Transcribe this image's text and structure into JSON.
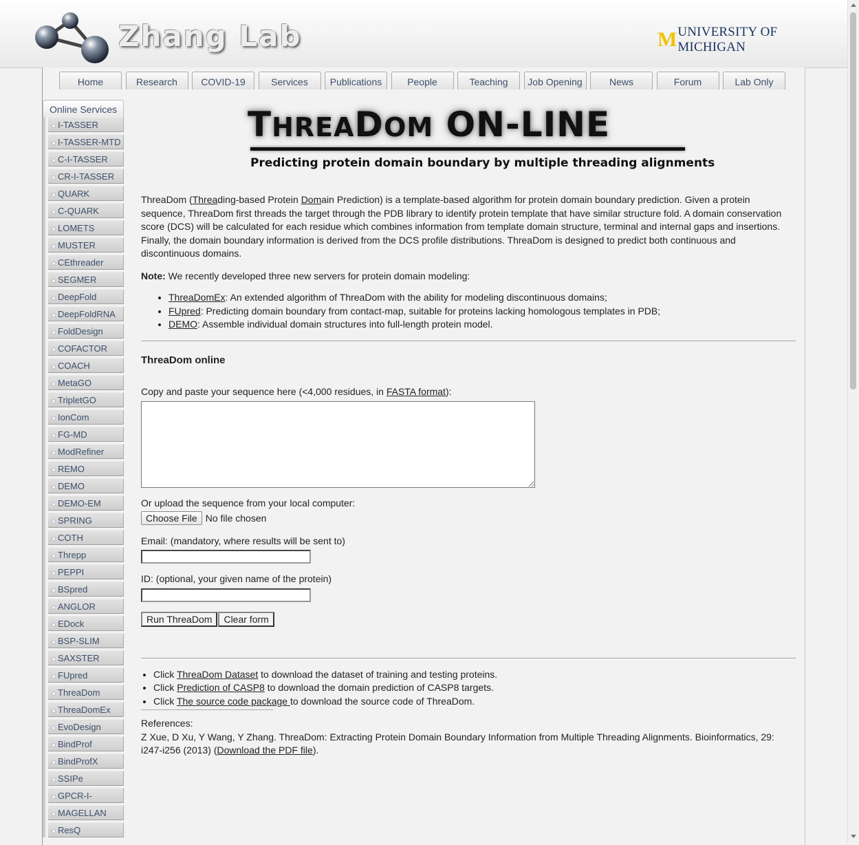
{
  "header": {
    "lab_name": "Zhang Lab",
    "university_initial": "M",
    "university_name": "UNIVERSITY OF MICHIGAN"
  },
  "nav": {
    "tabs": [
      "Home",
      "Research",
      "COVID-19",
      "Services",
      "Publications",
      "People",
      "Teaching",
      "Job Opening",
      "News",
      "Forum",
      "Lab Only"
    ]
  },
  "sidebar": {
    "title": "Online Services",
    "items": [
      "I-TASSER",
      "I-TASSER-MTD",
      "C-I-TASSER",
      "CR-I-TASSER",
      "QUARK",
      "C-QUARK",
      "LOMETS",
      "MUSTER",
      "CEthreader",
      "SEGMER",
      "DeepFold",
      "DeepFoldRNA",
      "FoldDesign",
      "COFACTOR",
      "COACH",
      "MetaGO",
      "TripletGO",
      "IonCom",
      "FG-MD",
      "ModRefiner",
      "REMO",
      "DEMO",
      "DEMO-EM",
      "SPRING",
      "COTH",
      "Threpp",
      "PEPPI",
      "BSpred",
      "ANGLOR",
      "EDock",
      "BSP-SLIM",
      "SAXSTER",
      "FUpred",
      "ThreaDom",
      "ThreaDomEx",
      "EvoDesign",
      "BindProf",
      "BindProfX",
      "SSIPe",
      "GPCR-I-TASSER",
      "MAGELLAN",
      "ResQ"
    ]
  },
  "banner": {
    "title_t": "T",
    "title_hrea": "HREA",
    "title_d": "D",
    "title_om": "OM",
    "title_online": "ON-LINE",
    "subtitle": "Predicting protein domain boundary by multiple threading alignments"
  },
  "intro": {
    "p1_a": "ThreaDom (",
    "p1_threa": "Threa",
    "p1_b": "ding-based Protein ",
    "p1_dom": "Dom",
    "p1_c": "ain Prediction) is a template-based algorithm for protein domain boundary prediction. Given a protein sequence, ThreaDom first threads the target through the PDB library to identify protein template that have similar structure fold. A domain conservation score (DCS) will be calculated for each residue which combines information from template domain structure, terminal and internal gaps and insertions. Finally, the domain boundary information is derived from the DCS profile distributions. ThreaDom is designed to predict both continuous and discontinuous domains.",
    "note_label": "Note:",
    "note_text": " We recently developed three new servers for protein domain modeling:",
    "servers": [
      {
        "name": "ThreaDomEx",
        "desc": ": An extended algorithm of ThreaDom with the ability for modeling discontinuous domains;"
      },
      {
        "name": "FUpred",
        "desc": ": Predicting domain boundary from contact-map, suitable for proteins lacking homologous templates in PDB;"
      },
      {
        "name": "DEMO",
        "desc": ": Assemble individual domain structures into full-length protein model."
      }
    ]
  },
  "form": {
    "heading": "ThreaDom online",
    "seq_label_a": "Copy and paste your sequence here (<4,000 residues, in ",
    "seq_label_link": "FASTA format",
    "seq_label_b": "):",
    "upload_label": "Or upload the sequence from your local computer:",
    "choose_file": "Choose File",
    "file_status": "No file chosen",
    "email_label": "Email: (mandatory, where results will be sent to)",
    "id_label": "ID: (optional, your given name of the protein)",
    "run_button": "Run ThreaDom",
    "clear_button": "Clear form"
  },
  "downloads": [
    {
      "pre": "Click ",
      "link": "ThreaDom Dataset",
      "post": " to download the dataset of training and testing proteins."
    },
    {
      "pre": "Click ",
      "link": "Prediction of CASP8",
      "post": " to download the domain prediction of CASP8 targets."
    },
    {
      "pre": "Click ",
      "link": "The source code package ",
      "post": "to download the source code of ThreaDom."
    }
  ],
  "references": {
    "label": "References:",
    "citation": "Z Xue, D Xu, Y Wang, Y Zhang. ThreaDom: Extracting Protein Domain Boundary Information from Multiple Threading Alignments. Bioinformatics, 29: i247-i256 (2013) (",
    "pdf_link": "Download the PDF file",
    "close": ")."
  }
}
